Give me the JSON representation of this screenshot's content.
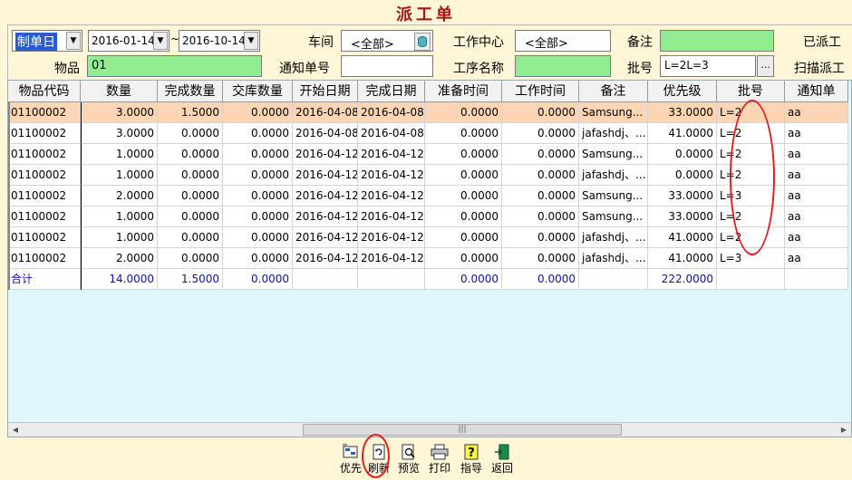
{
  "window": {
    "title": "派工单"
  },
  "filters": {
    "date_type": "制单日",
    "date_from": "2016-01-14",
    "date_sep": "~",
    "date_to": "2016-10-14",
    "workshop_label": "车间",
    "workshop_value": "<全部>",
    "work_center_label": "工作中心",
    "work_center_value": "<全部>",
    "remark_label": "备注",
    "remark_value": "",
    "dispatched_label": "已派工",
    "item_label": "物品",
    "item_value": "01",
    "notice_no_label": "通知单号",
    "notice_no_value": "",
    "process_label": "工序名称",
    "process_value": "",
    "batch_label": "批号",
    "batch_value": "L=2L=3",
    "ellipsis": "...",
    "scan_label": "扫描派工"
  },
  "table": {
    "columns": [
      "物品代码",
      "数量",
      "完成数量",
      "交库数量",
      "开始日期",
      "完成日期",
      "准备时间",
      "工作时间",
      "备注",
      "优先级",
      "批号",
      "通知单"
    ],
    "rows": [
      [
        "01100002",
        "3.0000",
        "1.5000",
        "0.0000",
        "2016-04-08",
        "2016-04-08",
        "0.0000",
        "0.0000",
        "Samsung...",
        "33.0000",
        "L=2",
        "aa"
      ],
      [
        "01100002",
        "3.0000",
        "0.0000",
        "0.0000",
        "2016-04-08",
        "2016-04-08",
        "0.0000",
        "0.0000",
        "jafashdj、...",
        "41.0000",
        "L=2",
        "aa"
      ],
      [
        "01100002",
        "1.0000",
        "0.0000",
        "0.0000",
        "2016-04-12",
        "2016-04-12",
        "0.0000",
        "0.0000",
        "Samsung...",
        "0.0000",
        "L=2",
        "aa"
      ],
      [
        "01100002",
        "1.0000",
        "0.0000",
        "0.0000",
        "2016-04-12",
        "2016-04-12",
        "0.0000",
        "0.0000",
        "jafashdj、...",
        "0.0000",
        "L=2",
        "aa"
      ],
      [
        "01100002",
        "2.0000",
        "0.0000",
        "0.0000",
        "2016-04-12",
        "2016-04-12",
        "0.0000",
        "0.0000",
        "Samsung...",
        "33.0000",
        "L=3",
        "aa"
      ],
      [
        "01100002",
        "1.0000",
        "0.0000",
        "0.0000",
        "2016-04-12",
        "2016-04-12",
        "0.0000",
        "0.0000",
        "Samsung...",
        "33.0000",
        "L=2",
        "aa"
      ],
      [
        "01100002",
        "1.0000",
        "0.0000",
        "0.0000",
        "2016-04-12",
        "2016-04-12",
        "0.0000",
        "0.0000",
        "jafashdj、...",
        "41.0000",
        "L=2",
        "aa"
      ],
      [
        "01100002",
        "2.0000",
        "0.0000",
        "0.0000",
        "2016-04-12",
        "2016-04-12",
        "0.0000",
        "0.0000",
        "jafashdj、...",
        "41.0000",
        "L=3",
        "aa"
      ]
    ],
    "totals": [
      "合计",
      "14.0000",
      "1.5000",
      "0.0000",
      "",
      "",
      "0.0000",
      "0.0000",
      "",
      "222.0000",
      "",
      ""
    ],
    "selected_row": 0
  },
  "scrollbar": {
    "grip": "|||"
  },
  "toolbar": {
    "buttons": [
      {
        "label": "优先",
        "icon": "priority-icon"
      },
      {
        "label": "刷新",
        "icon": "refresh-icon"
      },
      {
        "label": "预览",
        "icon": "preview-icon"
      },
      {
        "label": "打印",
        "icon": "printer-icon"
      },
      {
        "label": "指导",
        "icon": "help-icon"
      },
      {
        "label": "返回",
        "icon": "exit-icon"
      }
    ]
  },
  "colors": {
    "background": "#fef6d6",
    "title": "#a31515",
    "grid_bg": "#dff6fb",
    "selected_row": "#fcd5b5",
    "input_green": "#90ee90",
    "annotation": "#e02020",
    "total_text": "#1010b0"
  }
}
